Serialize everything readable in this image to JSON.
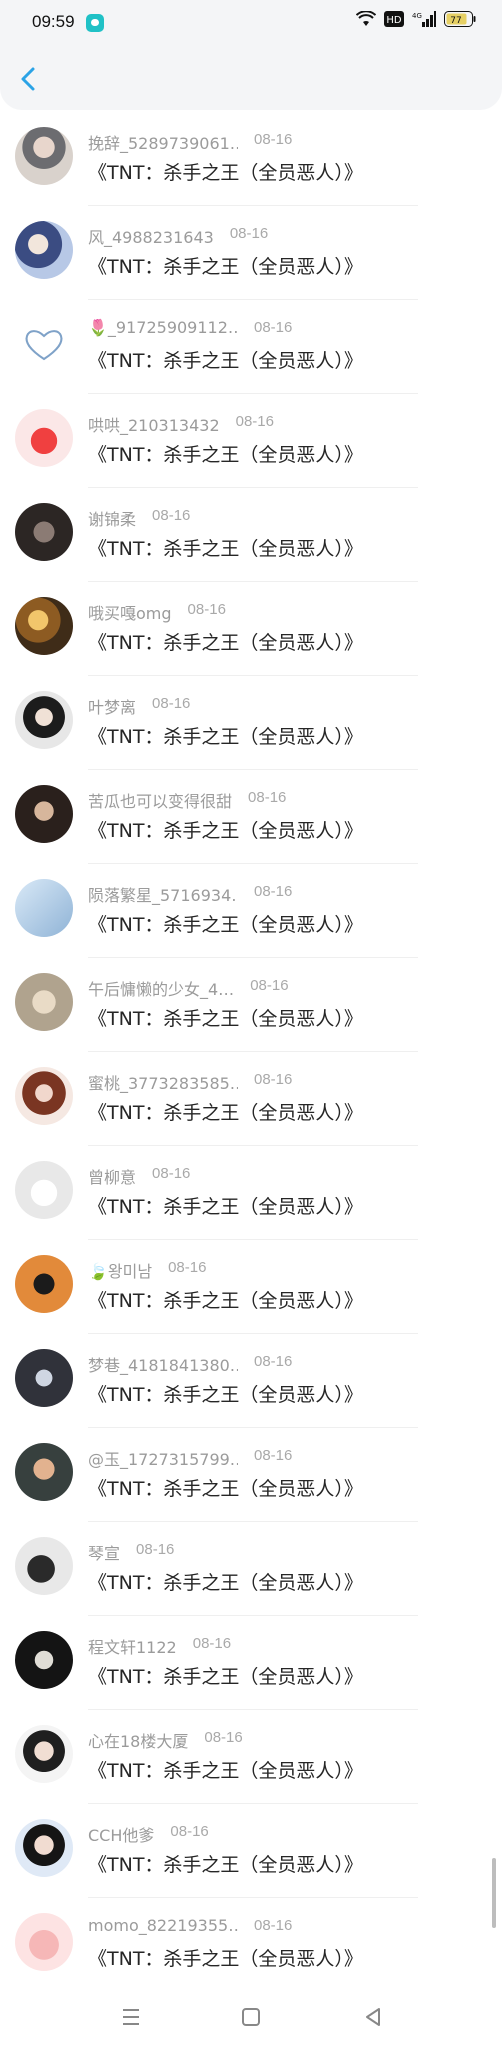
{
  "status": {
    "time": "09:59",
    "battery": "77",
    "hd": "HD",
    "network": "4G",
    "wifi_icon": "wifi-icon",
    "app_icon": "chat-app-icon"
  },
  "header": {
    "back_icon": "chevron-left-icon"
  },
  "items": [
    {
      "name": "挽辞_5289739061…",
      "date": "08-16",
      "text": "《TNT：杀手之王（全员恶人）》"
    },
    {
      "name": "风_4988231643",
      "date": "08-16",
      "text": "《TNT：杀手之王（全员恶人）》"
    },
    {
      "name": "🌷_91725909112…",
      "date": "08-16",
      "text": "《TNT：杀手之王（全员恶人）》"
    },
    {
      "name": "哄哄_210313432",
      "date": "08-16",
      "text": "《TNT：杀手之王（全员恶人）》"
    },
    {
      "name": "谢锦柔",
      "date": "08-16",
      "text": "《TNT：杀手之王（全员恶人）》"
    },
    {
      "name": "哦买嘎omg",
      "date": "08-16",
      "text": "《TNT：杀手之王（全员恶人）》"
    },
    {
      "name": "叶梦离",
      "date": "08-16",
      "text": "《TNT：杀手之王（全员恶人）》"
    },
    {
      "name": "苦瓜也可以变得很甜",
      "date": "08-16",
      "text": "《TNT：杀手之王（全员恶人）》"
    },
    {
      "name": "陨落繁星_5716934…",
      "date": "08-16",
      "text": "《TNT：杀手之王（全员恶人）》"
    },
    {
      "name": "午后慵懒的少女_4…",
      "date": "08-16",
      "text": "《TNT：杀手之王（全员恶人）》"
    },
    {
      "name": "蜜桃_3773283585…",
      "date": "08-16",
      "text": "《TNT：杀手之王（全员恶人）》"
    },
    {
      "name": "曾柳意",
      "date": "08-16",
      "text": "《TNT：杀手之王（全员恶人）》"
    },
    {
      "name": "🍃왕미남",
      "date": "08-16",
      "text": "《TNT：杀手之王（全员恶人）》"
    },
    {
      "name": "梦巷_4181841380…",
      "date": "08-16",
      "text": "《TNT：杀手之王（全员恶人）》"
    },
    {
      "name": "@玉_1727315799…",
      "date": "08-16",
      "text": "《TNT：杀手之王（全员恶人）》"
    },
    {
      "name": "琴宣",
      "date": "08-16",
      "text": "《TNT：杀手之王（全员恶人）》"
    },
    {
      "name": "程文轩1122",
      "date": "08-16",
      "text": "《TNT：杀手之王（全员恶人）》"
    },
    {
      "name": "心在18楼大厦",
      "date": "08-16",
      "text": "《TNT：杀手之王（全员恶人）》"
    },
    {
      "name": "CCH他爹",
      "date": "08-16",
      "text": "《TNT：杀手之王（全员恶人）》"
    },
    {
      "name": "momo_82219355…",
      "date": "08-16",
      "text": "《TNT：杀手之王（全员恶人）》"
    }
  ],
  "navbar": {
    "menu_icon": "menu-icon",
    "home_icon": "home-square-icon",
    "back_icon": "back-triangle-icon"
  }
}
